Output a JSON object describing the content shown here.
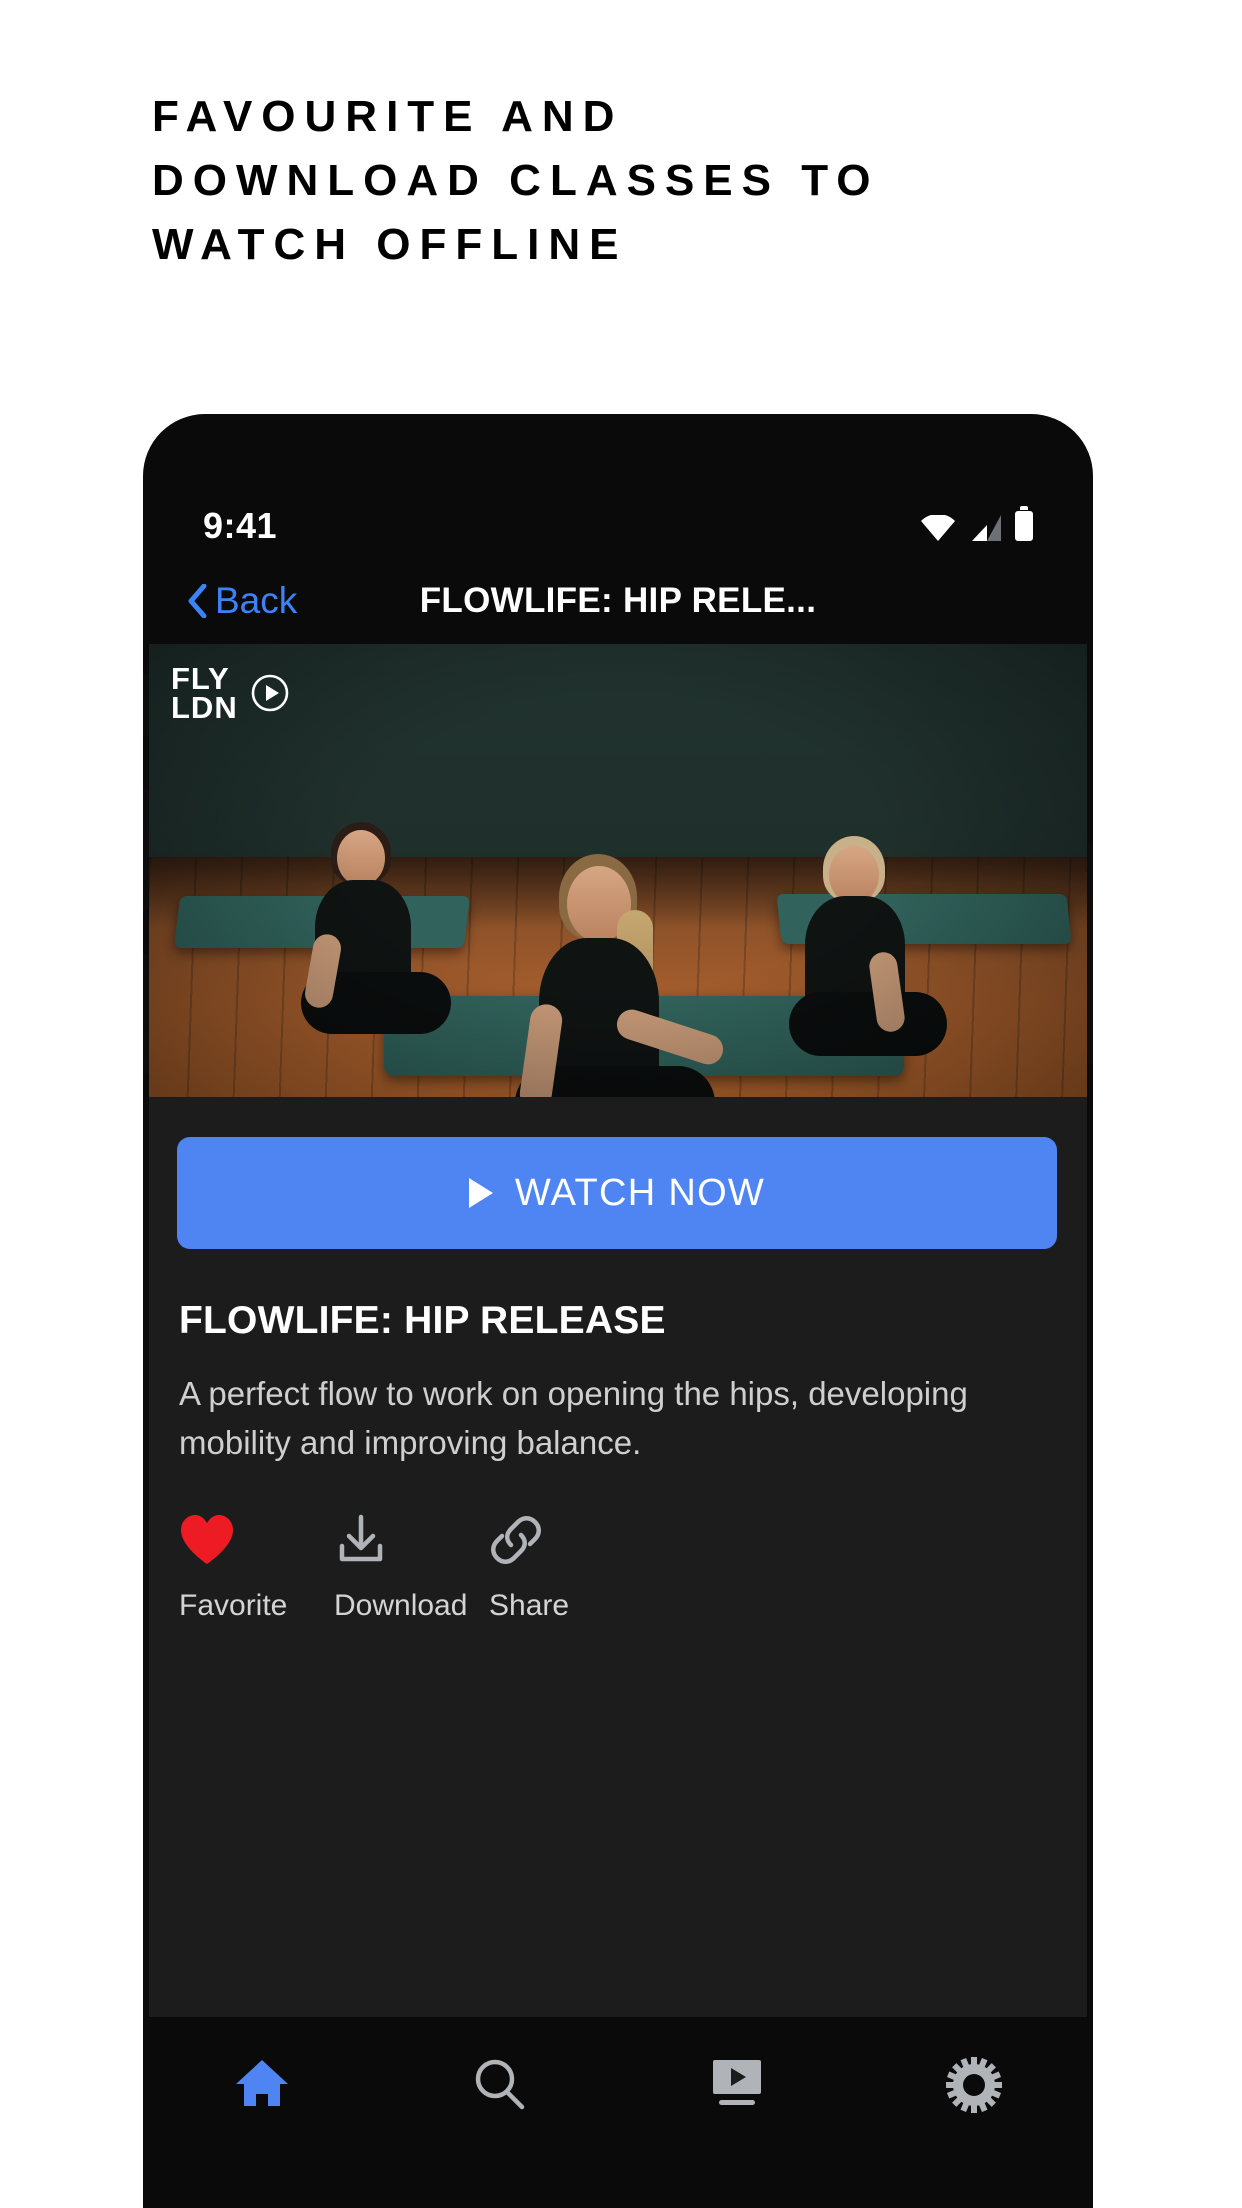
{
  "headline": {
    "lines": [
      "FAVOURITE AND",
      "DOWNLOAD CLASSES TO",
      "WATCH OFFLINE"
    ]
  },
  "colors": {
    "accent_blue": "#4f85f2",
    "link_blue": "#3b83f6",
    "favorite_red": "#ed1c24",
    "panel_bg": "#1c1c1c",
    "phone_bg": "#0a0a0a",
    "icon_gray": "#b0b3b8"
  },
  "phone": {
    "status_bar": {
      "time": "9:41",
      "icons": [
        "wifi-icon",
        "cellular-signal-icon",
        "battery-icon"
      ]
    },
    "nav_bar": {
      "back_label": "Back",
      "back_icon": "chevron-left-icon",
      "title": "FLOWLIFE: HIP RELE..."
    },
    "video": {
      "brand_line1": "FLY",
      "brand_line2": "LDN",
      "brand_play_icon": "play-circle-icon"
    },
    "main": {
      "watch_button": {
        "label": "WATCH NOW",
        "icon": "play-triangle-icon"
      },
      "class_title": "FLOWLIFE: HIP RELEASE",
      "class_description": "A perfect flow to work on opening the hips, developing mobility and improving balance.",
      "actions": [
        {
          "label": "Favorite",
          "icon": "heart-filled-icon",
          "state": "active"
        },
        {
          "label": "Download",
          "icon": "download-icon",
          "state": "inactive"
        },
        {
          "label": "Share",
          "icon": "link-icon",
          "state": "inactive"
        }
      ]
    },
    "tab_bar": {
      "items": [
        {
          "name": "home",
          "icon": "home-icon",
          "active": true
        },
        {
          "name": "search",
          "icon": "search-icon",
          "active": false
        },
        {
          "name": "videos",
          "icon": "tv-play-icon",
          "active": false
        },
        {
          "name": "settings",
          "icon": "gear-icon",
          "active": false
        }
      ]
    }
  }
}
